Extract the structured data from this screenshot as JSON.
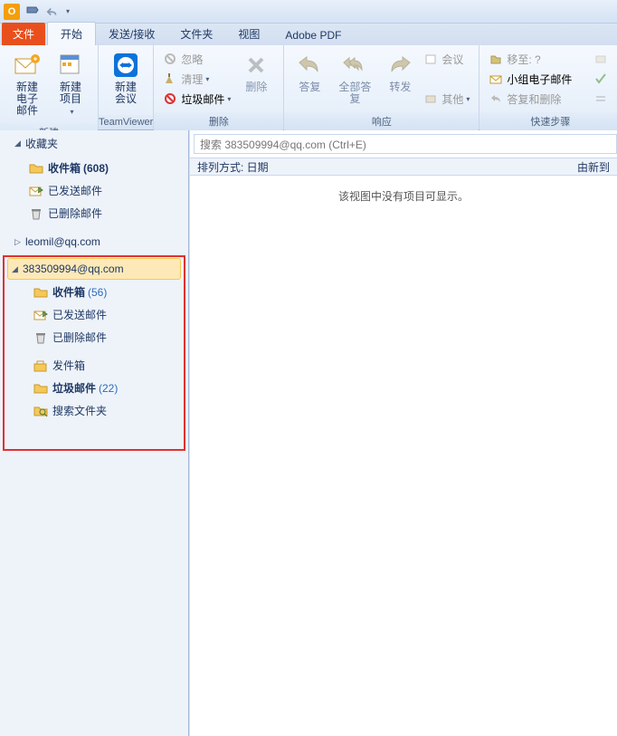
{
  "titlebar": {
    "app_badge": "O"
  },
  "tabs": {
    "file": "文件",
    "home": "开始",
    "sendreceive": "发送/接收",
    "folder": "文件夹",
    "view": "视图",
    "adobe": "Adobe PDF"
  },
  "ribbon": {
    "new": {
      "new_email": "新建\n电子邮件",
      "new_items": "新建项目",
      "group_label": "新建"
    },
    "teamviewer": {
      "new_meeting": "新建\n会议",
      "group_label": "TeamViewer"
    },
    "delete": {
      "ignore": "忽略",
      "cleanup": "清理",
      "junk": "垃圾邮件",
      "delete": "删除",
      "group_label": "删除"
    },
    "respond": {
      "reply": "答复",
      "reply_all": "全部答复",
      "forward": "转发",
      "meeting": "会议",
      "other": "其他",
      "group_label": "响应"
    },
    "quicksteps": {
      "moveto": "移至: ?",
      "team_email": "小组电子邮件",
      "reply_delete": "答复和删除",
      "group_label": "快速步骤"
    }
  },
  "nav": {
    "favorites_header": "收藏夹",
    "favorites": [
      {
        "label": "收件箱",
        "count": "(608)"
      },
      {
        "label": "已发送邮件",
        "count": ""
      },
      {
        "label": "已删除邮件",
        "count": ""
      }
    ],
    "account1": "leomil@qq.com",
    "account2": "383509994@qq.com",
    "account2_items": [
      {
        "label": "收件箱",
        "count": "(56)",
        "bold": true
      },
      {
        "label": "已发送邮件",
        "count": ""
      },
      {
        "label": "已删除邮件",
        "count": ""
      }
    ],
    "account2_items2": [
      {
        "label": "发件箱",
        "count": ""
      },
      {
        "label": "垃圾邮件",
        "count": "(22)",
        "bold": true
      },
      {
        "label": "搜索文件夹",
        "count": ""
      }
    ]
  },
  "content": {
    "search_placeholder": "搜索 383509994@qq.com (Ctrl+E)",
    "sort_by": "排列方式: 日期",
    "sort_dir": "由新到",
    "empty": "该视图中没有项目可显示。"
  }
}
